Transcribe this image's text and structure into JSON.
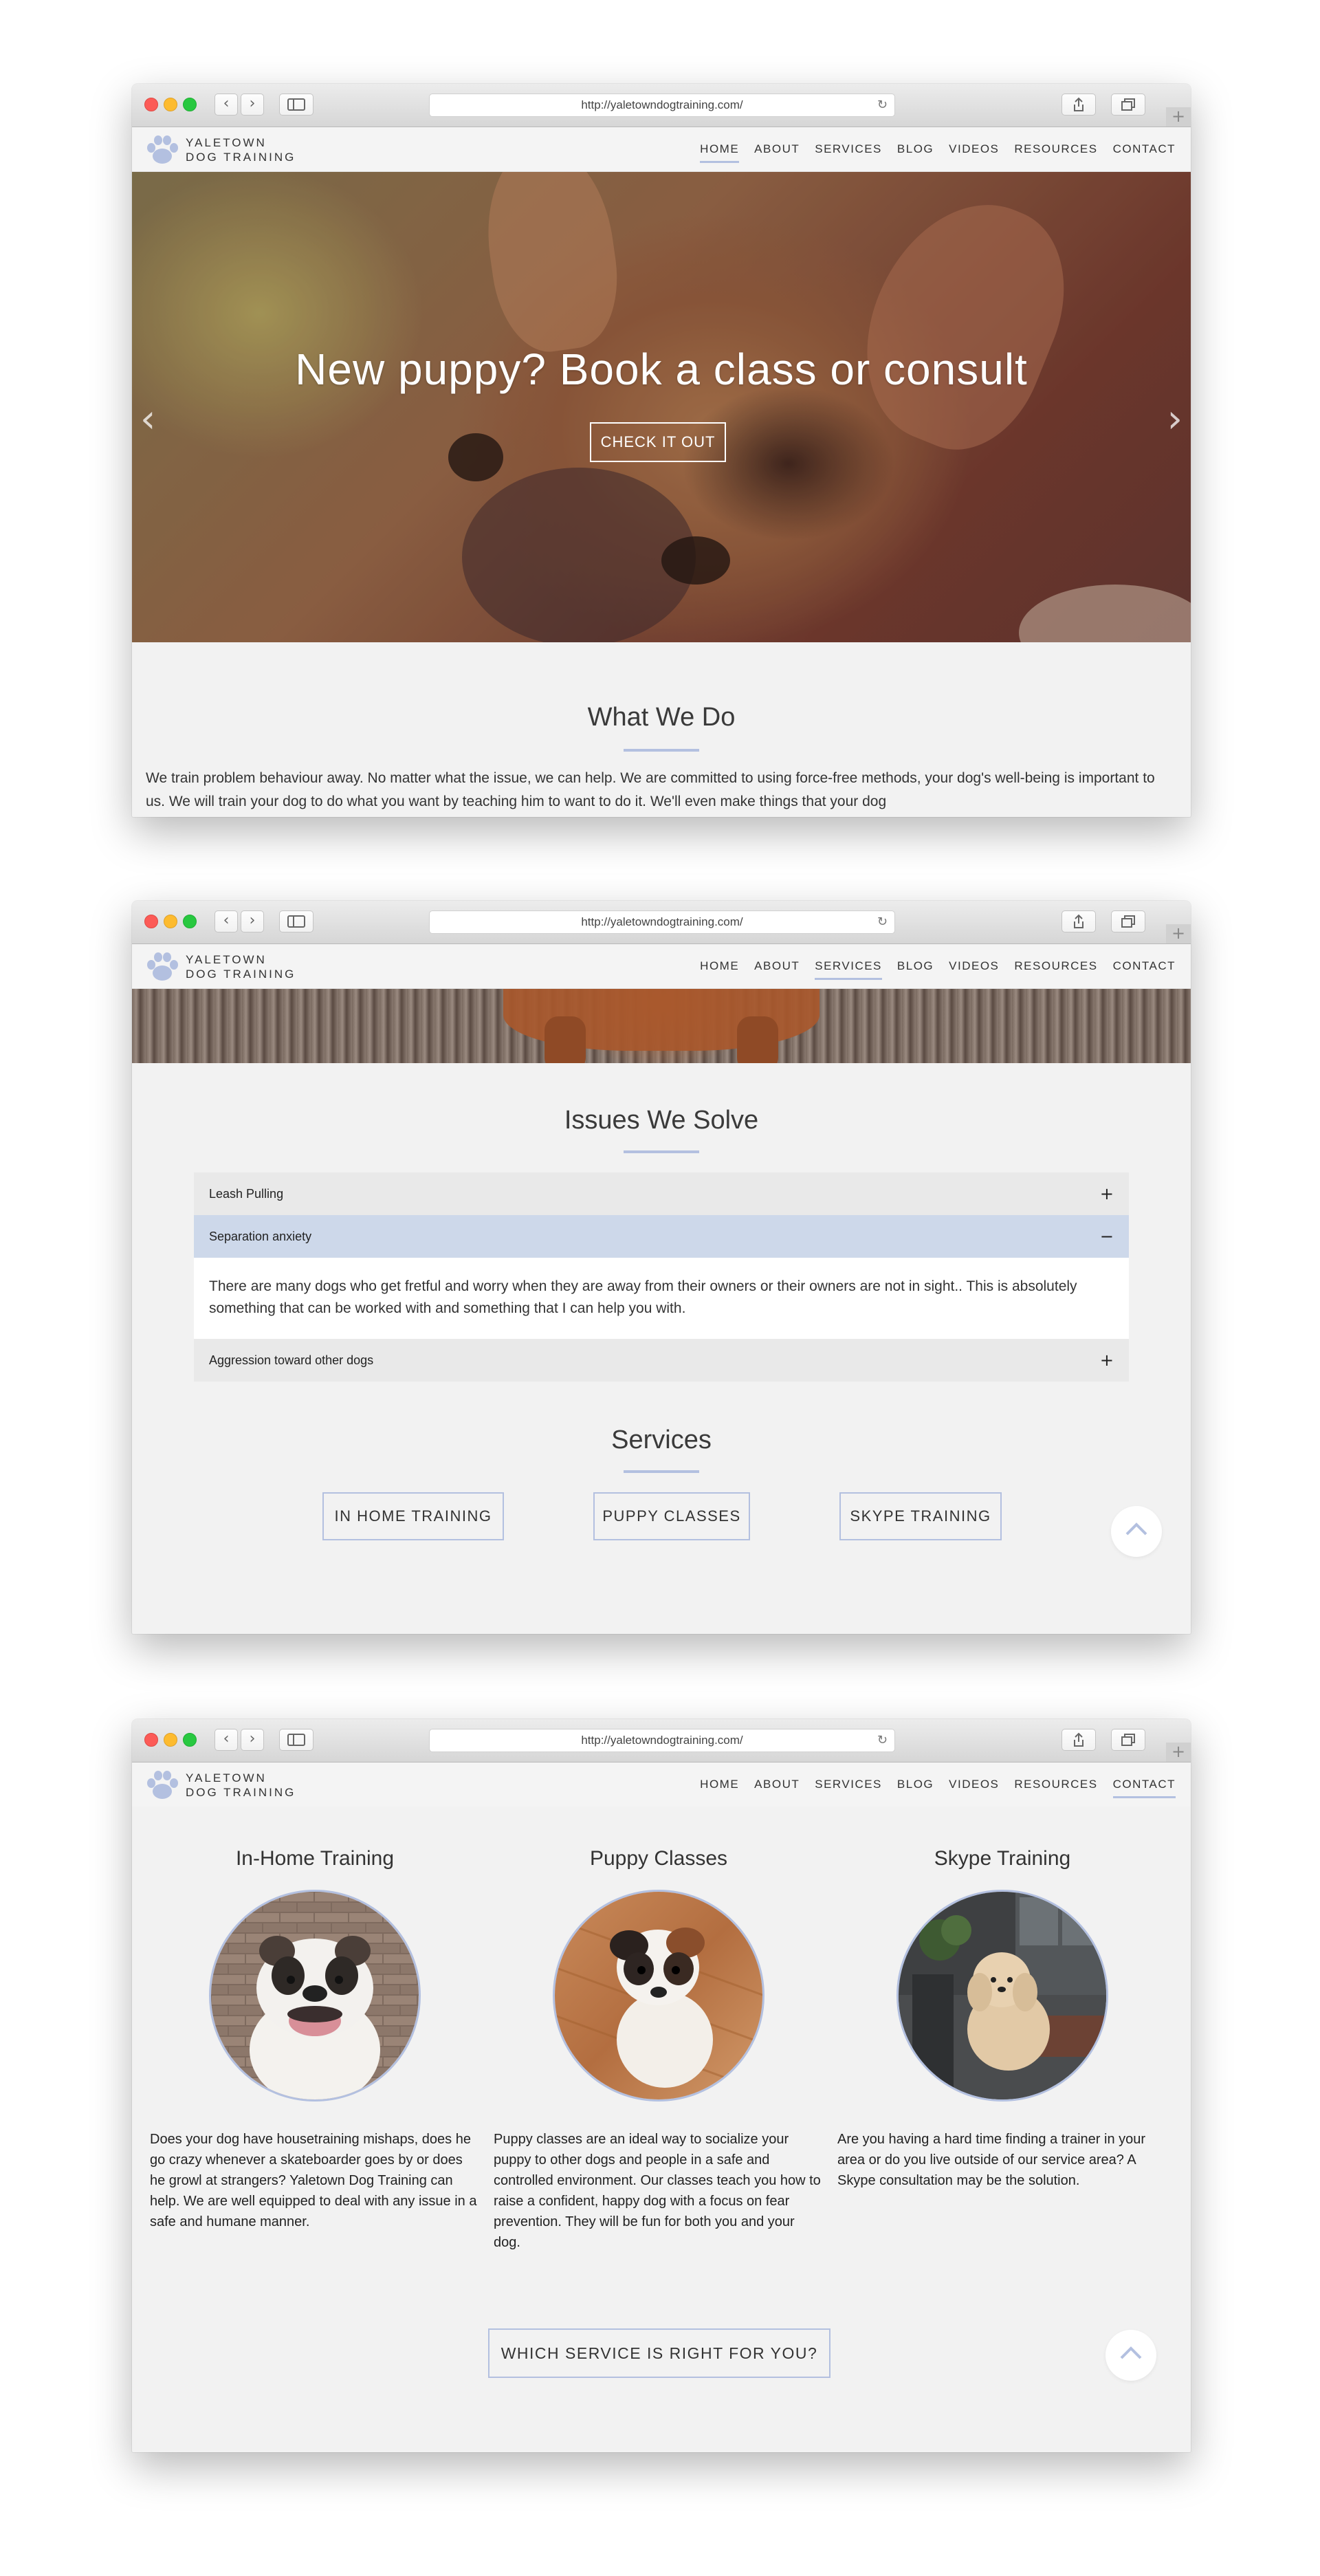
{
  "browser": {
    "url": "http://yaletowndogtraining.com/",
    "back_icon": "chevron-left-icon",
    "forward_icon": "chevron-right-icon"
  },
  "site": {
    "logo_line1": "YALETOWN",
    "logo_line2": "DOG TRAINING",
    "nav": [
      "HOME",
      "ABOUT",
      "SERVICES",
      "BLOG",
      "VIDEOS",
      "RESOURCES",
      "CONTACT"
    ]
  },
  "colors": {
    "accent": "#b3c0e0",
    "accordion_open": "#cdd8ea"
  },
  "hero": {
    "title": "New puppy? Book a class or consult",
    "button": "CHECK IT OUT"
  },
  "what_we_do": {
    "title": "What We Do",
    "text": "We train problem behaviour away. No matter what the issue, we can help. We are committed to using force-free methods, your dog's well-being is important to us. We will train your dog to do what you want by teaching him to want to do it. We'll even make things that your dog"
  },
  "issues": {
    "title": "Issues We Solve",
    "items": [
      {
        "label": "Leash Pulling",
        "sign": "+"
      },
      {
        "label": "Separation anxiety",
        "sign": "−",
        "body": "There are many dogs who get fretful and worry when they are away from their owners or their owners are not in sight.. This is absolutely something that can be worked with and something that I can help you with."
      },
      {
        "label": "Aggression toward other dogs",
        "sign": "+"
      }
    ]
  },
  "services": {
    "title": "Services",
    "buttons": [
      "IN HOME TRAINING",
      "PUPPY CLASSES",
      "SKYPE TRAINING"
    ]
  },
  "service_details": [
    {
      "title": "In-Home Training",
      "text": "Does your dog have housetraining mishaps, does he go crazy whenever a skateboarder goes by or does he growl at strangers? Yaletown Dog Training can help. We are well equipped to deal with any issue in a safe and humane manner."
    },
    {
      "title": "Puppy Classes",
      "text": "Puppy classes are an ideal way to socialize your puppy to other dogs and people in a safe and controlled environment. Our classes teach you how to raise a confident, happy dog with a focus on fear prevention. They will be fun for both you and your dog."
    },
    {
      "title": "Skype Training",
      "text": "Are you having a hard time finding a trainer in your area or do you live outside of our service area? A Skype consultation may be the solution."
    }
  ],
  "which_service_button": "WHICH SERVICE IS RIGHT FOR YOU?"
}
